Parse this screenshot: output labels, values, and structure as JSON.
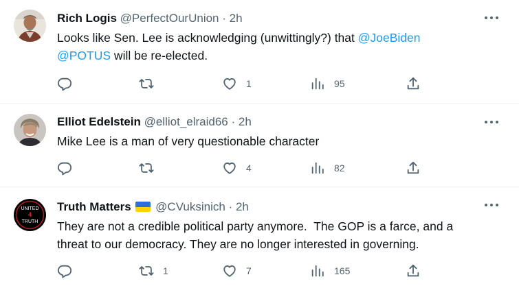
{
  "tweets": [
    {
      "name": "Rich Logis",
      "handle": "@PerfectOurUnion",
      "separator": "·",
      "time": "2h",
      "text_parts": {
        "intro": "Looks like Sen. Lee is acknowledging (unwittingly?) that ",
        "mention1": "@JoeBiden",
        "mention2": "@POTUS",
        "outro": " will be re-elected."
      },
      "replies": "",
      "retweets": "",
      "likes": "1",
      "views": "95"
    },
    {
      "name": "Elliot Edelstein",
      "handle": "@elliot_elraid66",
      "separator": "·",
      "time": "2h",
      "text": "Mike Lee is a man of very questionable character",
      "replies": "",
      "retweets": "",
      "likes": "4",
      "views": "82"
    },
    {
      "name": "Truth Matters",
      "flag": "ukraine-flag",
      "handle": "@CVuksinich",
      "separator": "·",
      "time": "2h",
      "text_line1": "They are not a credible political party anymore.  The GOP is a farce, and a",
      "text_line2": "threat to our democracy. They are no longer interested in governing.",
      "avatar_text": [
        "UNITED",
        "4",
        "TRUTH"
      ],
      "replies": "",
      "retweets": "1",
      "likes": "7",
      "views": "165"
    }
  ],
  "colors": {
    "text": "#0f1419",
    "secondary": "#536471",
    "link": "#1d9bf0",
    "divider": "#eff3f4"
  },
  "icons": [
    "reply-icon",
    "retweet-icon",
    "like-icon",
    "views-icon",
    "share-icon",
    "more-icon"
  ]
}
